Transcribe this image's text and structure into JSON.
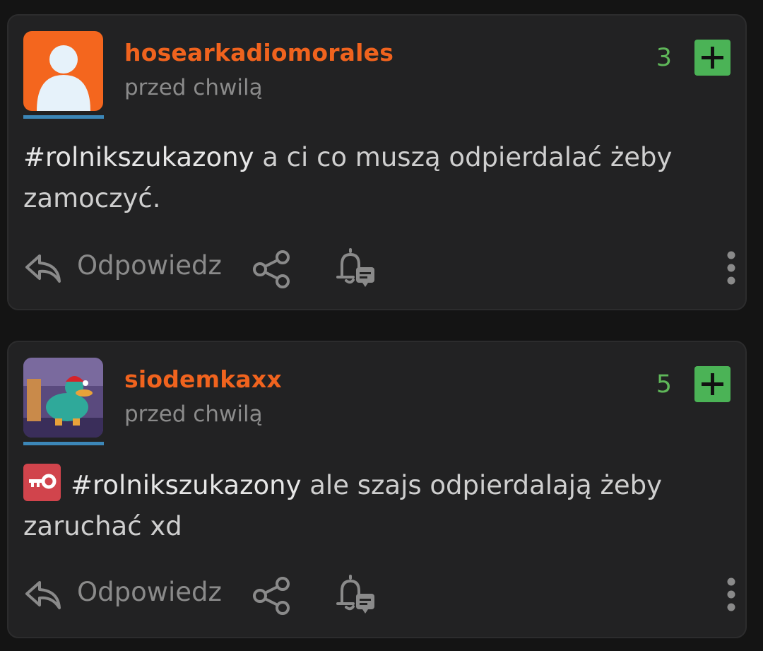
{
  "colors": {
    "username": "#f0631e",
    "score": "#5fb759",
    "plus": "#4bb356",
    "badge": "#d1444c"
  },
  "posts": [
    {
      "username": "hosearkadiomorales",
      "time": "przed chwilą",
      "score": "3",
      "hashtag": "#rolnikszukazony",
      "text": " a ci co muszą odpierdalać żeby zamoczyć.",
      "reply_label": "Odpowiedz",
      "avatar": "default-user-avatar"
    },
    {
      "username": "siodemkaxx",
      "time": "przed chwilą",
      "score": "5",
      "hashtag": "#rolnikszukazony",
      "text": " ale szajs odpierdalają żeby zaruchać xd",
      "reply_label": "Odpowiedz",
      "avatar": "platypus-cartoon-avatar",
      "badge_icon": "key-icon"
    }
  ]
}
